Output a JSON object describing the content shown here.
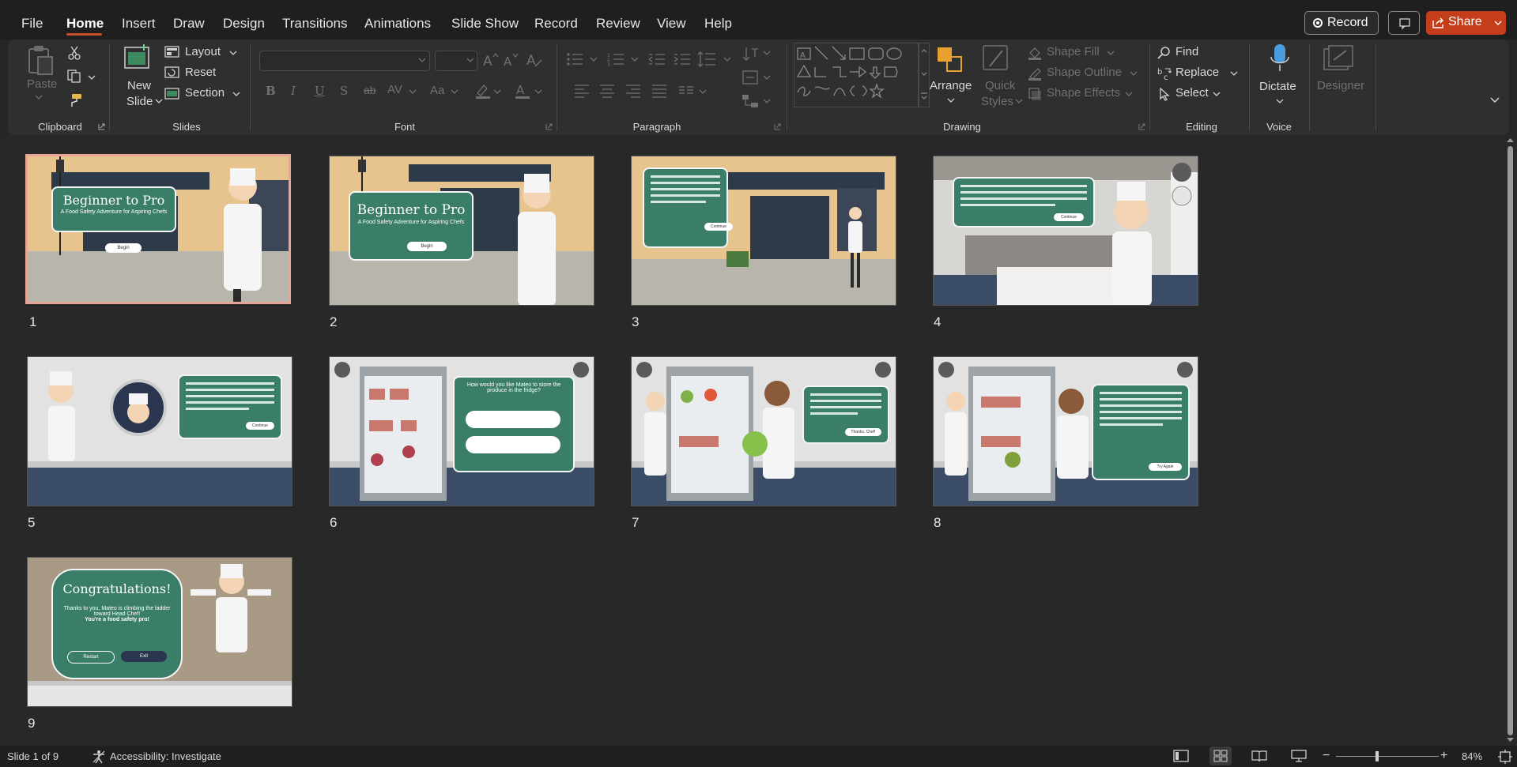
{
  "menu": {
    "tabs": [
      "File",
      "Home",
      "Insert",
      "Draw",
      "Design",
      "Transitions",
      "Animations",
      "Slide Show",
      "Record",
      "Review",
      "View",
      "Help"
    ],
    "active_tab": "Home",
    "record_button": "Record",
    "share_button": "Share"
  },
  "ribbon": {
    "clipboard": {
      "paste": "Paste",
      "group": "Clipboard"
    },
    "slides": {
      "new_slide_1": "New",
      "new_slide_2": "Slide",
      "layout": "Layout",
      "reset": "Reset",
      "section": "Section",
      "group": "Slides"
    },
    "font": {
      "font_name": "",
      "font_size": "",
      "group": "Font"
    },
    "paragraph": {
      "group": "Paragraph"
    },
    "drawing": {
      "arrange": "Arrange",
      "quick_styles_1": "Quick",
      "quick_styles_2": "Styles",
      "shape_fill": "Shape Fill",
      "shape_outline": "Shape Outline",
      "shape_effects": "Shape Effects",
      "group": "Drawing"
    },
    "editing": {
      "find": "Find",
      "replace": "Replace",
      "select": "Select",
      "group": "Editing"
    },
    "voice": {
      "dictate": "Dictate",
      "group": "Voice"
    },
    "designer": {
      "label": "Designer"
    }
  },
  "slides": [
    {
      "number": "1",
      "title": "Beginner to Pro",
      "subtitle": "A Food Safety Adventure for Aspiring Chefs",
      "button": "Begin"
    },
    {
      "number": "2",
      "title": "Beginner to Pro",
      "subtitle": "A Food Safety Adventure for Aspiring Chefs",
      "button": "Begin"
    },
    {
      "number": "3",
      "button": "Continue"
    },
    {
      "number": "4",
      "button": "Continue"
    },
    {
      "number": "5",
      "button": "Continue"
    },
    {
      "number": "6",
      "question": "How would you like Mateo to store the produce in the fridge?"
    },
    {
      "number": "7",
      "button": "Thanks, Chef!"
    },
    {
      "number": "8",
      "button": "Try Again"
    },
    {
      "number": "9",
      "title": "Congratulations!",
      "body": "Thanks to you, Mateo is climbing the ladder toward Head Chef!",
      "body_bold": "You're a food safety pro!",
      "restart": "Restart",
      "exit": "Exit"
    }
  ],
  "status": {
    "slide_indicator": "Slide 1 of 9",
    "accessibility": "Accessibility: Investigate",
    "zoom_level": "84%"
  },
  "colors": {
    "accent": "#c43e1c",
    "bubble": "#3a7d68",
    "selection": "#e9a593"
  }
}
